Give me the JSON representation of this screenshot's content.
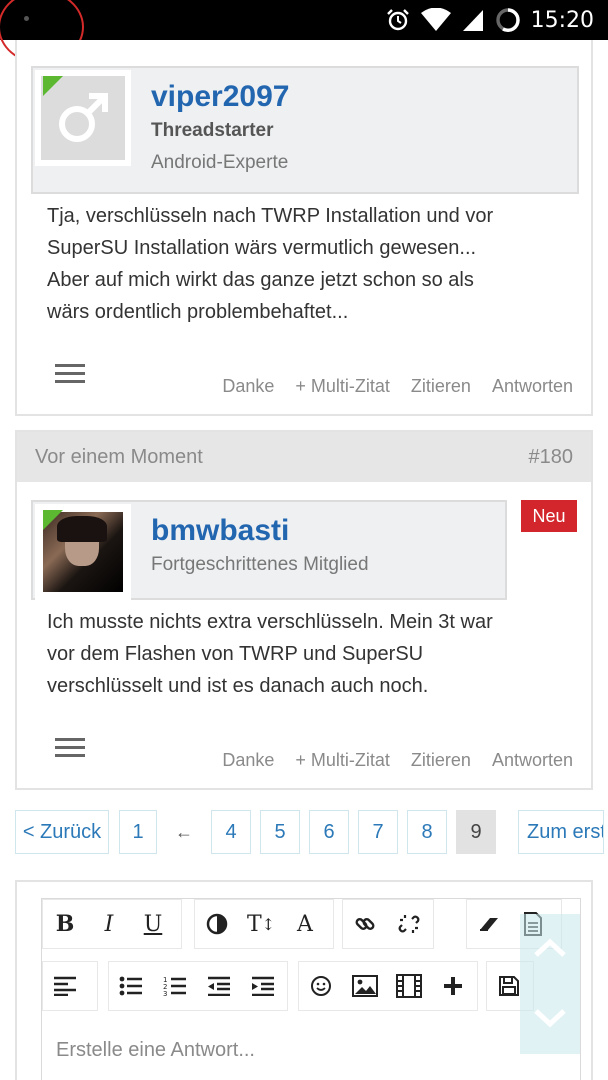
{
  "status_bar": {
    "time": "15:20"
  },
  "post1": {
    "username": "viper2097",
    "role": "Threadstarter",
    "rank": "Android-Experte",
    "avatar": "male-symbol-icon",
    "body": [
      "Tja, verschlüsseln nach TWRP Installation und vor",
      "SuperSU Installation wärs vermutlich gewesen...",
      "Aber auf mich wirkt das ganze jetzt schon so als",
      "wärs ordentlich problembehaftet..."
    ],
    "actions": [
      "Danke",
      "+ Multi-Zitat",
      "Zitieren",
      "Antworten"
    ]
  },
  "post2": {
    "time": "Vor einem Moment",
    "number": "#180",
    "username": "bmwbasti",
    "rank": "Fortgeschrittenes Mitglied",
    "badge": "Neu",
    "body": [
      "Ich musste nichts extra verschlüsseln. Mein 3t war",
      "vor dem Flashen von TWRP und SuperSU",
      "verschlüsselt und ist es danach auch noch."
    ],
    "actions": [
      "Danke",
      "+ Multi-Zitat",
      "Zitieren",
      "Antworten"
    ]
  },
  "pagination": {
    "back": "< Zurück",
    "first": "1",
    "ellipsis": "←",
    "pages": [
      "4",
      "5",
      "6",
      "7",
      "8",
      "9"
    ],
    "current": "9",
    "next": "Zum erst"
  },
  "editor": {
    "placeholder": "Erstelle eine Antwort...",
    "bold": "B",
    "italic": "I",
    "underline": "U",
    "font_color": "A"
  },
  "colors": {
    "accent": "#2266b0",
    "badge": "#d2262c",
    "online": "#5bb830"
  }
}
